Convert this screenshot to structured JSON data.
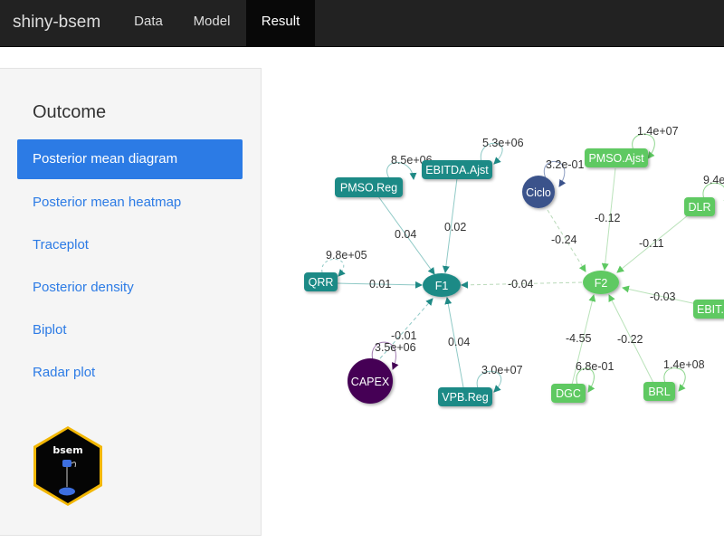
{
  "navbar": {
    "brand": "shiny-bsem",
    "tabs": [
      {
        "label": "Data",
        "active": false
      },
      {
        "label": "Model",
        "active": false
      },
      {
        "label": "Result",
        "active": true
      }
    ]
  },
  "sidebar": {
    "title": "Outcome",
    "items": [
      {
        "label": "Posterior mean diagram",
        "active": true
      },
      {
        "label": "Posterior mean heatmap",
        "active": false
      },
      {
        "label": "Traceplot",
        "active": false
      },
      {
        "label": "Posterior density",
        "active": false
      },
      {
        "label": "Biplot",
        "active": false
      },
      {
        "label": "Radar plot",
        "active": false
      }
    ],
    "logo_text": "bsem"
  },
  "diagram": {
    "colors": {
      "f1": "#1f8a86",
      "f2": "#5ec962",
      "ciclo": "#3b528b",
      "capex": "#440154",
      "edge_f1": "#4aa7a3",
      "edge_f2": "#8fd68f"
    },
    "nodes": {
      "f1": "F1",
      "f2": "F2",
      "pmso_reg": "PMSO.Reg",
      "ebitda_ajst": "EBITDA.Ajst",
      "qrr": "QRR",
      "vpb_reg": "VPB.Reg",
      "capex": "CAPEX",
      "ciclo": "Ciclo",
      "pmso_ajst": "PMSO.Ajst",
      "dlr": "DLR",
      "ebit": "EBIT.",
      "dgc": "DGC",
      "brl": "BRL"
    },
    "loadings": {
      "pmso_reg": "0.04",
      "ebitda_ajst": "0.02",
      "qrr": "0.01",
      "vpb_reg": "0.04",
      "capex": "-0.01",
      "f1_f2": "-0.04",
      "ciclo": "-0.24",
      "pmso_ajst": "-0.12",
      "dlr": "-0.11",
      "ebit": "-0.03",
      "dgc": "-4.55",
      "brl": "-0.22"
    },
    "variances": {
      "pmso_reg": "8.5e+06",
      "ebitda_ajst": "5.3e+06",
      "qrr": "9.8e+05",
      "vpb_reg": "3.0e+07",
      "capex": "3.5e+06",
      "ciclo": "3.2e-01",
      "pmso_ajst": "1.4e+07",
      "dlr": "9.4e",
      "dgc": "6.8e-01",
      "brl": "1.4e+08"
    }
  }
}
